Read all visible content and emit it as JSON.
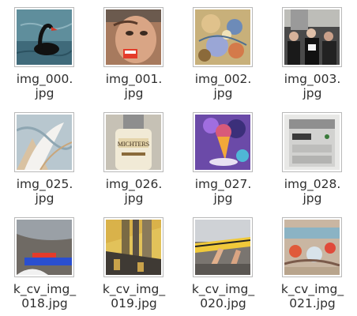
{
  "files": [
    {
      "line1": "img_000.",
      "line2": "jpg",
      "icon": "image-thumbnail-black-swan-icon"
    },
    {
      "line1": "img_001.",
      "line2": "jpg",
      "icon": "image-thumbnail-face-icon"
    },
    {
      "line1": "img_002.",
      "line2": "jpg",
      "icon": "image-thumbnail-floral-icon"
    },
    {
      "line1": "img_003.",
      "line2": "jpg",
      "icon": "image-thumbnail-crowd-icon"
    },
    {
      "line1": "img_025.",
      "line2": "jpg",
      "icon": "image-thumbnail-feather-icon"
    },
    {
      "line1": "img_026.",
      "line2": "jpg",
      "icon": "image-thumbnail-bottle-icon"
    },
    {
      "line1": "img_027.",
      "line2": "jpg",
      "icon": "image-thumbnail-ice-cream-icon"
    },
    {
      "line1": "img_028.",
      "line2": "jpg",
      "icon": "image-thumbnail-copier-icon"
    },
    {
      "line1": "k_cv_img_",
      "line2": "018.jpg",
      "icon": "image-thumbnail-cat-icon"
    },
    {
      "line1": "k_cv_img_",
      "line2": "019.jpg",
      "icon": "image-thumbnail-building-icon"
    },
    {
      "line1": "k_cv_img_",
      "line2": "020.jpg",
      "icon": "image-thumbnail-arms-icon"
    },
    {
      "line1": "k_cv_img_",
      "line2": "021.jpg",
      "icon": "image-thumbnail-pattern-icon"
    }
  ]
}
